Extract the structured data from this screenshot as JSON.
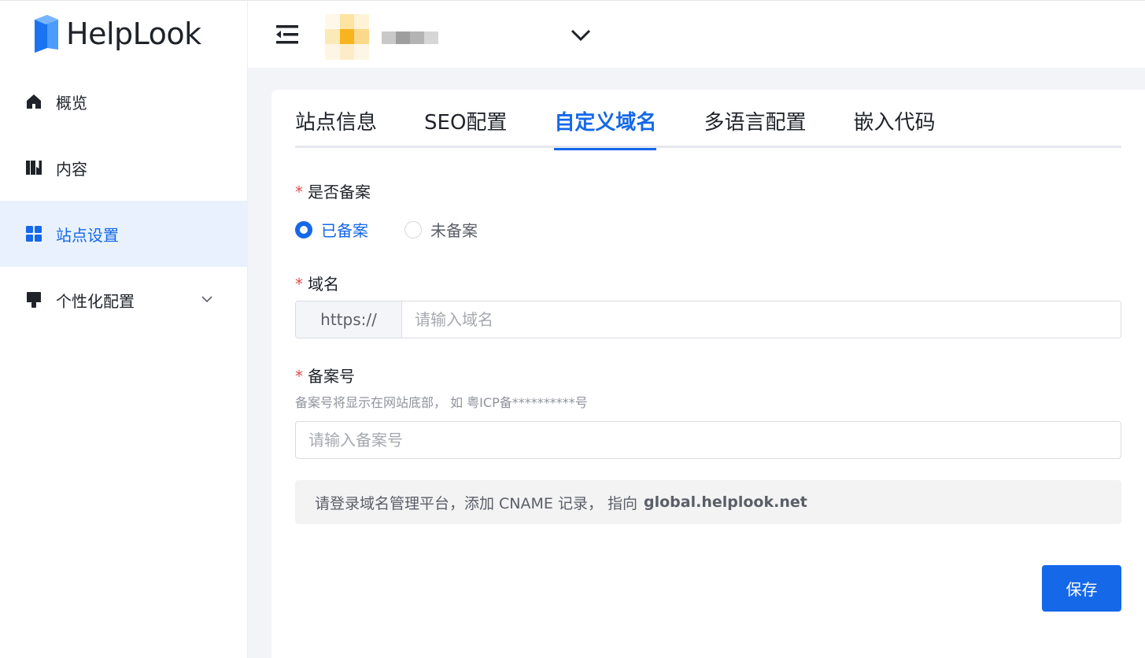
{
  "brand": {
    "name": "HelpLook"
  },
  "sidebar": {
    "items": [
      {
        "label": "概览",
        "icon": "home-icon",
        "active": false
      },
      {
        "label": "内容",
        "icon": "book-icon",
        "active": false
      },
      {
        "label": "站点设置",
        "icon": "grid-icon",
        "active": true
      },
      {
        "label": "个性化配置",
        "icon": "paint-brush-icon",
        "active": false,
        "expandable": true
      }
    ]
  },
  "tabs": [
    {
      "label": "站点信息",
      "active": false
    },
    {
      "label": "SEO配置",
      "active": false
    },
    {
      "label": "自定义域名",
      "active": true
    },
    {
      "label": "多语言配置",
      "active": false
    },
    {
      "label": "嵌入代码",
      "active": false
    }
  ],
  "form": {
    "filing": {
      "label": "是否备案",
      "options": [
        {
          "label": "已备案",
          "checked": true
        },
        {
          "label": "未备案",
          "checked": false
        }
      ]
    },
    "domain": {
      "label": "域名",
      "prefix": "https://",
      "placeholder": "请输入域名",
      "value": ""
    },
    "icp": {
      "label": "备案号",
      "hint": "备案号将显示在网站底部， 如 粤ICP备**********号",
      "placeholder": "请输入备案号",
      "value": ""
    },
    "notice": {
      "text": "请登录域名管理平台，添加 CNAME 记录， 指向",
      "target": "global.helplook.net"
    },
    "save_label": "保存",
    "required_mark": "*"
  },
  "colors": {
    "primary": "#1568e8",
    "active_bg": "#e8f1fd",
    "required": "#e34d4d",
    "page_bg": "#f3f4f7"
  }
}
